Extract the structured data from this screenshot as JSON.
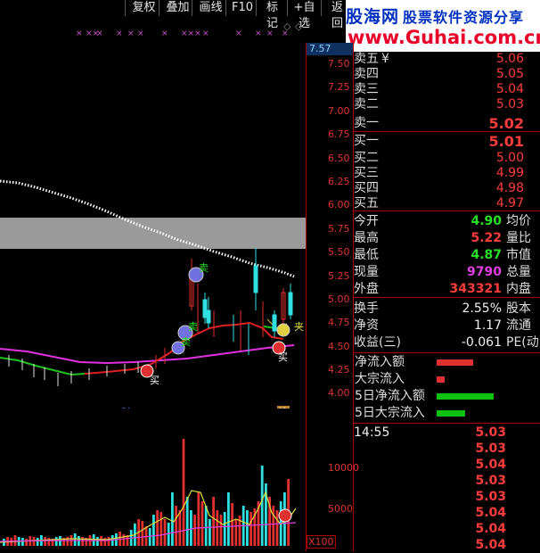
{
  "toolbar": {
    "items": [
      "复权",
      "叠加",
      "画线",
      "F10",
      "标记",
      "+自选",
      "返回"
    ]
  },
  "watermark": {
    "line1_a": "股",
    "line1_b": "海网",
    "line1_c": "股票软件资源分享",
    "line2": "www.Guhai.com.cn"
  },
  "axis": {
    "current_price": "7.57",
    "price_ticks": [
      "7.50",
      "7.25",
      "7.00",
      "6.75",
      "6.50",
      "6.25",
      "6.00",
      "5.75",
      "5.50",
      "5.25",
      "5.00",
      "4.75",
      "4.50",
      "4.25",
      "4.00"
    ],
    "volume_ticks": [
      "10000",
      "5000"
    ],
    "volume_unit": "X100"
  },
  "chart_labels": {
    "cai": "财",
    "bang": "榜",
    "mai": "买",
    "mai2": "卖",
    "jia": "夹"
  },
  "orderbook": {
    "sell": [
      {
        "label": "卖五",
        "extra": "¥",
        "price": "5.06"
      },
      {
        "label": "卖四",
        "price": "5.05"
      },
      {
        "label": "卖三",
        "price": "5.04"
      },
      {
        "label": "卖二",
        "price": "5.03"
      },
      {
        "label": "卖一",
        "price": "5.02"
      }
    ],
    "buy": [
      {
        "label": "买一",
        "price": "5.01"
      },
      {
        "label": "买二",
        "price": "5.00"
      },
      {
        "label": "买三",
        "price": "4.99"
      },
      {
        "label": "买四",
        "price": "4.98"
      },
      {
        "label": "买五",
        "price": "4.97"
      }
    ]
  },
  "quote": {
    "rows": [
      {
        "label": "今开",
        "value": "4.90",
        "color": "green",
        "label2": "均价"
      },
      {
        "label": "最高",
        "value": "5.22",
        "color": "red",
        "label2": "量比"
      },
      {
        "label": "最低",
        "value": "4.87",
        "color": "green",
        "label2": "市值"
      },
      {
        "label": "现量",
        "value": "9790",
        "color": "mag",
        "label2": "总量"
      },
      {
        "label": "外盘",
        "value": "343321",
        "color": "red",
        "label2": "内盘"
      }
    ],
    "rows2": [
      {
        "label": "换手",
        "value": "2.55%",
        "label2": "股本"
      },
      {
        "label": "净资",
        "value": "1.17",
        "label2": "流通"
      },
      {
        "label": "收益(三)",
        "value": "-0.061",
        "label2": "PE(动"
      }
    ]
  },
  "flow": {
    "items": [
      {
        "label": "净流入额",
        "bar": 0.48,
        "color": "#e03030"
      },
      {
        "label": "大宗流入",
        "bar": 0.1,
        "color": "#e03030"
      },
      {
        "label": "5日净流入额",
        "bar": 0.75,
        "color": "#10c010"
      },
      {
        "label": "5日大宗流入",
        "bar": 0.38,
        "color": "#10c010"
      }
    ]
  },
  "ticks": {
    "time": "14:55",
    "prices": [
      "5.03",
      "5.03",
      "5.04",
      "5.03",
      "5.03",
      "5.04",
      "5.04",
      "5.04"
    ]
  }
}
